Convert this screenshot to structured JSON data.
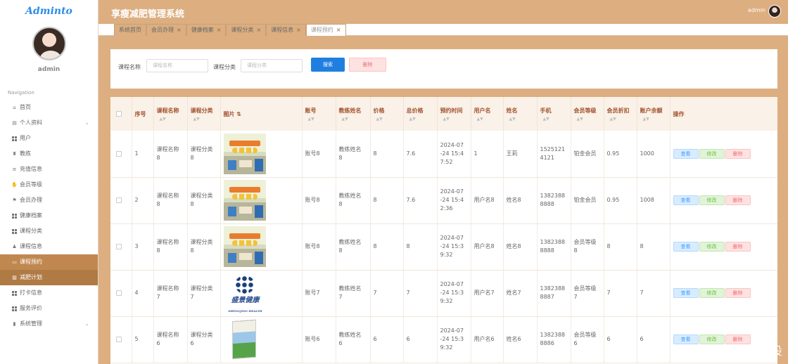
{
  "sidebar": {
    "logo": "Adminto",
    "username": "admin",
    "nav_title": "Navigation",
    "items": [
      {
        "label": "首页",
        "icon": "home-icon"
      },
      {
        "label": "个人资料",
        "icon": "profile-icon"
      },
      {
        "label": "用户",
        "icon": "grid-icon"
      },
      {
        "label": "教练",
        "icon": "trophy-icon"
      },
      {
        "label": "充值信息",
        "icon": "list-icon"
      },
      {
        "label": "会员等级",
        "icon": "thumb-icon"
      },
      {
        "label": "会员办理",
        "icon": "flag-icon"
      },
      {
        "label": "健康档案",
        "icon": "grid-icon"
      },
      {
        "label": "课程分类",
        "icon": "grid-icon"
      },
      {
        "label": "课程信息",
        "icon": "user-icon"
      },
      {
        "label": "课程预约",
        "icon": "monitor-icon"
      },
      {
        "label": "减肥计划",
        "icon": "book-icon"
      },
      {
        "label": "打卡信息",
        "icon": "grid-icon"
      },
      {
        "label": "服务评价",
        "icon": "grid-icon"
      },
      {
        "label": "系统管理",
        "icon": "chart-icon"
      }
    ]
  },
  "header": {
    "title": "享瘦减肥管理系统",
    "admin": "admin"
  },
  "tabs": [
    {
      "label": "系统首页",
      "closable": false
    },
    {
      "label": "会员办理",
      "closable": true
    },
    {
      "label": "健康档案",
      "closable": true
    },
    {
      "label": "课程分类",
      "closable": true
    },
    {
      "label": "课程信息",
      "closable": true
    },
    {
      "label": "课程预约",
      "closable": true
    }
  ],
  "search": {
    "name_label": "课程名称",
    "name_placeholder": "课程名称",
    "cat_label": "课程分类",
    "cat_placeholder": "课程分类",
    "search_btn": "搜索",
    "delete_btn": "删除"
  },
  "table": {
    "headers": [
      "序号",
      "课程名称",
      "课程分类",
      "图片",
      "账号",
      "教练姓名",
      "价格",
      "总价格",
      "预约时间",
      "用户名",
      "姓名",
      "手机",
      "会员等级",
      "会员折扣",
      "账户余额",
      "操作"
    ],
    "rows": [
      {
        "no": "1",
        "name": "课程名称\n8",
        "cat": "课程分类\n8",
        "img": "scene",
        "acc": "账号8",
        "coach": "教练姓名\n8",
        "price": "8",
        "total": "7.6",
        "time": "2024-07\n-24 15:4\n7:52",
        "uname": "1",
        "realname": "王莉",
        "phone": "1525121\n4121",
        "level": "铂金会员",
        "disc": "0.95",
        "bal": "1000"
      },
      {
        "no": "2",
        "name": "课程名称\n8",
        "cat": "课程分类\n8",
        "img": "scene",
        "acc": "账号8",
        "coach": "教练姓名\n8",
        "price": "8",
        "total": "7.6",
        "time": "2024-07\n-24 15:4\n2:36",
        "uname": "用户名8",
        "realname": "姓名8",
        "phone": "1382388\n8888",
        "level": "铂金会员",
        "disc": "0.95",
        "bal": "1008"
      },
      {
        "no": "3",
        "name": "课程名称\n8",
        "cat": "课程分类\n8",
        "img": "scene",
        "acc": "账号8",
        "coach": "教练姓名\n8",
        "price": "8",
        "total": "8",
        "time": "2024-07\n-24 15:3\n9:32",
        "uname": "用户名8",
        "realname": "姓名8",
        "phone": "1382388\n8888",
        "level": "会员等级\n8",
        "disc": "8",
        "bal": "8"
      },
      {
        "no": "4",
        "name": "课程名称\n7",
        "cat": "课程分类\n7",
        "img": "logo",
        "acc": "账号7",
        "coach": "教练姓名\n7",
        "price": "7",
        "total": "7",
        "time": "2024-07\n-24 15:3\n9:32",
        "uname": "用户名7",
        "realname": "姓名7",
        "phone": "1382388\n8887",
        "level": "会员等级\n7",
        "disc": "7",
        "bal": "7"
      },
      {
        "no": "5",
        "name": "课程名称\n6",
        "cat": "课程分类\n6",
        "img": "book",
        "acc": "账号6",
        "coach": "教练姓名\n6",
        "price": "6",
        "total": "6",
        "time": "2024-07\n-24 15:3\n9:32",
        "uname": "用户名6",
        "realname": "姓名6",
        "phone": "1382388\n8886",
        "level": "会员等级\n6",
        "disc": "6",
        "bal": "6"
      }
    ],
    "ops": {
      "view": "查看",
      "edit": "修改",
      "remove": "删除"
    },
    "logo_text": "盛景健康",
    "logo_sub": "SHENGJING HEALTH"
  },
  "watermark": "CSDN @一点毕设",
  "colors": {
    "accent": "#dcae80",
    "active_nav": "#c08850",
    "search_btn": "#1f7fe0",
    "danger": "#f56c6c"
  }
}
